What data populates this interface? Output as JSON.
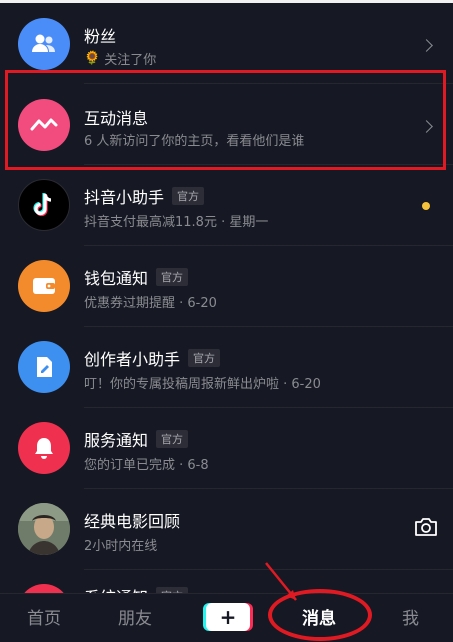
{
  "colors": {
    "fans_avatar": "#4b8df8",
    "interact_avatar": "#f24b7e",
    "helper_avatar": "#000000",
    "wallet_avatar": "#f38b2c",
    "creator_avatar": "#3d8ff0",
    "service_avatar": "#f0304f",
    "system_avatar": "#f0304f",
    "unread_dot": "#f5c33b",
    "annotation": "#e01a22"
  },
  "messages": [
    {
      "title": "粉丝",
      "sub_prefix": "🌻",
      "subtitle": "关注了你",
      "tag": "",
      "icon": "fans-icon",
      "right": "chevron"
    },
    {
      "title": "互动消息",
      "sub_prefix": "",
      "subtitle": "6 人新访问了你的主页，看看他们是谁",
      "tag": "",
      "icon": "interaction-icon",
      "right": "chevron"
    },
    {
      "title": "抖音小助手",
      "sub_prefix": "",
      "subtitle": "抖音支付最高减11.8元 · 星期一",
      "tag": "官方",
      "icon": "tiktok-logo-icon",
      "right": "unread-dot"
    },
    {
      "title": "钱包通知",
      "sub_prefix": "",
      "subtitle": "优惠券过期提醒 · 6-20",
      "tag": "官方",
      "icon": "wallet-icon",
      "right": ""
    },
    {
      "title": "创作者小助手",
      "sub_prefix": "",
      "subtitle": "叮！你的专属投稿周报新鲜出炉啦 · 6-20",
      "tag": "官方",
      "icon": "edit-icon",
      "right": ""
    },
    {
      "title": "服务通知",
      "sub_prefix": "",
      "subtitle": "您的订单已完成 · 6-8",
      "tag": "官方",
      "icon": "bell-icon",
      "right": ""
    },
    {
      "title": "经典电影回顾",
      "sub_prefix": "",
      "subtitle": "2小时内在线",
      "tag": "",
      "icon": "user-avatar",
      "right": "camera"
    },
    {
      "title": "系统通知",
      "sub_prefix": "",
      "subtitle": "",
      "tag": "官方",
      "icon": "system-icon",
      "right": ""
    }
  ],
  "tabs": {
    "home": "首页",
    "friends": "朋友",
    "create": "+",
    "messages": "消息",
    "me": "我"
  },
  "active_tab": "消息"
}
